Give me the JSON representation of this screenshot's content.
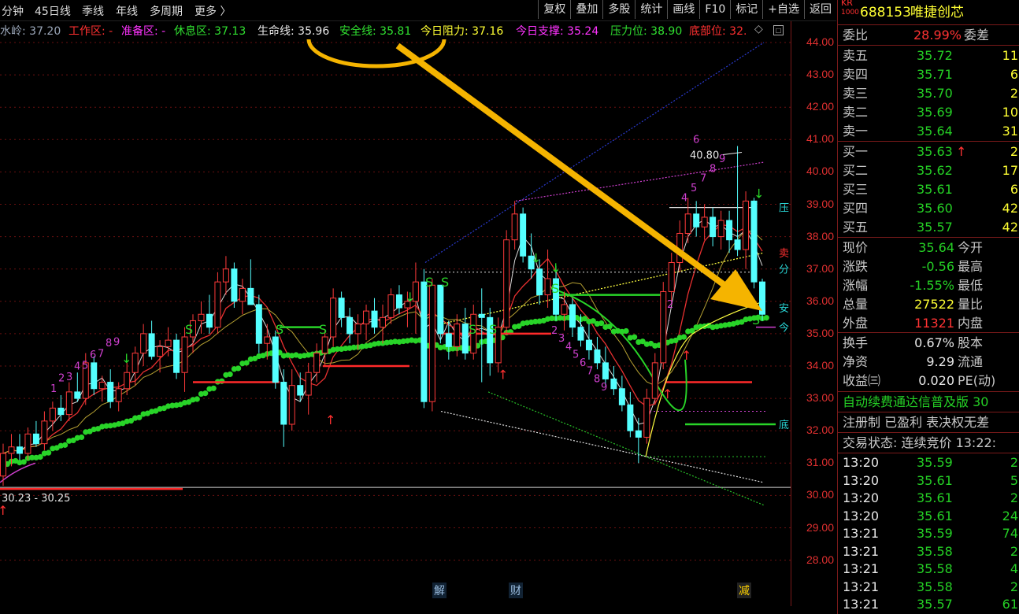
{
  "toolbar": {
    "tabs": [
      "分钟",
      "45日线",
      "季线",
      "年线",
      "多周期",
      "更多 〉"
    ],
    "buttons": [
      "复权",
      "叠加",
      "多股",
      "统计",
      "画线",
      "F10",
      "标记",
      "+自选",
      "返回"
    ]
  },
  "indicators": {
    "shuiling": "水岭: 37.20",
    "gongzuo": "工作区: -",
    "zhunbei": "准备区: -",
    "xiuxi": "休息区: 37.13",
    "shengming": "生命线: 35.96",
    "anquan": "安全线: 35.81",
    "zuli": "今日阻力: 37.16",
    "zhicheng": "今日支撑: 35.24",
    "yali": "压力位: 38.90",
    "dibu": "底部位: 32."
  },
  "price_axis": [
    "44.00",
    "43.00",
    "42.00",
    "41.00",
    "40.00",
    "39.00",
    "38.00",
    "37.00",
    "36.00",
    "35.00",
    "34.00",
    "33.00",
    "32.00",
    "31.00",
    "30.00",
    "29.00",
    "28.00"
  ],
  "chart_labels": {
    "high": "40.80",
    "low": "30.23 - 30.25",
    "event_jie": "解",
    "event_cai": "财",
    "event_jian": "减",
    "side_ya": "压",
    "side_fen": "分",
    "side_an": "安",
    "side_jin": "今",
    "side_di": "底",
    "side_mai": "卖"
  },
  "quote": {
    "badge_top": "KR",
    "badge_bottom": "1000",
    "code": "688153",
    "name": "唯捷创芯",
    "weibi_label": "委比",
    "weibi_value": "28.99%",
    "weicha_label": "委差",
    "asks": [
      {
        "label": "卖五",
        "price": "35.72",
        "vol": "11"
      },
      {
        "label": "卖四",
        "price": "35.71",
        "vol": "6"
      },
      {
        "label": "卖三",
        "price": "35.70",
        "vol": "2"
      },
      {
        "label": "卖二",
        "price": "35.69",
        "vol": "10"
      },
      {
        "label": "卖一",
        "price": "35.64",
        "vol": "31"
      }
    ],
    "bids": [
      {
        "label": "买一",
        "price": "35.63",
        "arrow": "↑",
        "vol": "2"
      },
      {
        "label": "买二",
        "price": "35.62",
        "arrow": "",
        "vol": "17"
      },
      {
        "label": "买三",
        "price": "35.61",
        "arrow": "",
        "vol": "6"
      },
      {
        "label": "买四",
        "price": "35.60",
        "arrow": "",
        "vol": "42"
      },
      {
        "label": "买五",
        "price": "35.57",
        "arrow": "",
        "vol": "42"
      }
    ],
    "stats": [
      {
        "label": "现价",
        "value": "35.64",
        "label2": "今开"
      },
      {
        "label": "涨跌",
        "value": "-0.56",
        "label2": "最高"
      },
      {
        "label": "涨幅",
        "value": "-1.55%",
        "label2": "最低"
      },
      {
        "label": "总量",
        "value": "27522",
        "label2": "量比"
      },
      {
        "label": "外盘",
        "value": "11321",
        "label2": "内盘"
      }
    ],
    "stats2": [
      {
        "label": "换手",
        "value": "0.67%",
        "label2": "股本"
      },
      {
        "label": "净资",
        "value": "9.29",
        "label2": "流通"
      },
      {
        "label": "收益㈢",
        "value": "0.020",
        "label2": "PE(动)"
      }
    ],
    "news": "自动续费通达信普及版 30",
    "status_line": "注册制 已盈利 表决权无差",
    "trade_state": "交易状态: 连续竞价 13:22:",
    "ticks": [
      {
        "time": "13:20",
        "price": "35.59",
        "vol": "2"
      },
      {
        "time": "13:20",
        "price": "35.61",
        "vol": "5"
      },
      {
        "time": "13:20",
        "price": "35.61",
        "vol": "2"
      },
      {
        "time": "13:20",
        "price": "35.61",
        "vol": "24"
      },
      {
        "time": "13:21",
        "price": "35.59",
        "vol": "74"
      },
      {
        "time": "13:21",
        "price": "35.58",
        "vol": "2"
      },
      {
        "time": "13:21",
        "price": "35.58",
        "vol": "4"
      },
      {
        "time": "13:21",
        "price": "35.58",
        "vol": "2"
      },
      {
        "time": "13:21",
        "price": "35.57",
        "vol": "61"
      }
    ]
  },
  "chart_data": {
    "type": "candlestick",
    "ylim": [
      27.3,
      44.4
    ],
    "candles": [
      [
        30.6,
        31.6,
        30.3,
        31.3
      ],
      [
        31.3,
        31.9,
        30.9,
        31.5
      ],
      [
        31.5,
        31.9,
        31.1,
        31.3
      ],
      [
        31.3,
        32.1,
        31.1,
        31.9
      ],
      [
        31.9,
        32.3,
        31.5,
        31.6
      ],
      [
        31.6,
        32.6,
        31.4,
        32.3
      ],
      [
        32.3,
        32.9,
        32.0,
        32.7
      ],
      [
        32.7,
        33.1,
        32.3,
        32.5
      ],
      [
        32.5,
        33.5,
        32.3,
        33.2
      ],
      [
        33.2,
        33.8,
        32.9,
        33.0
      ],
      [
        33.0,
        34.4,
        32.8,
        34.1
      ],
      [
        34.1,
        34.3,
        33.1,
        33.3
      ],
      [
        33.3,
        33.7,
        32.9,
        33.5
      ],
      [
        33.5,
        33.9,
        32.7,
        32.9
      ],
      [
        32.9,
        33.5,
        32.6,
        33.3
      ],
      [
        33.3,
        34.1,
        33.1,
        33.8
      ],
      [
        33.8,
        34.6,
        33.4,
        34.4
      ],
      [
        34.4,
        35.3,
        34.0,
        35.0
      ],
      [
        35.0,
        35.4,
        34.2,
        34.3
      ],
      [
        34.3,
        34.8,
        33.8,
        34.6
      ],
      [
        34.6,
        35.2,
        34.3,
        34.8
      ],
      [
        34.8,
        35.0,
        33.6,
        33.8
      ],
      [
        33.8,
        35.2,
        33.2,
        34.9
      ],
      [
        34.9,
        35.6,
        34.4,
        35.4
      ],
      [
        35.4,
        36.0,
        35.0,
        35.6
      ],
      [
        35.6,
        36.2,
        35.0,
        35.2
      ],
      [
        35.2,
        36.9,
        35.0,
        36.6
      ],
      [
        36.6,
        37.4,
        36.2,
        37.0
      ],
      [
        37.0,
        37.2,
        35.8,
        36.0
      ],
      [
        36.0,
        36.7,
        35.6,
        36.4
      ],
      [
        36.4,
        37.3,
        35.9,
        35.9
      ],
      [
        35.9,
        36.2,
        34.4,
        34.7
      ],
      [
        34.7,
        35.3,
        34.2,
        34.9
      ],
      [
        34.9,
        35.1,
        33.3,
        33.5
      ],
      [
        33.5,
        33.9,
        31.5,
        32.2
      ],
      [
        32.2,
        33.9,
        32.0,
        33.4
      ],
      [
        33.4,
        33.8,
        32.9,
        33.1
      ],
      [
        33.1,
        34.1,
        32.5,
        33.8
      ],
      [
        33.8,
        34.7,
        33.5,
        34.4
      ],
      [
        34.4,
        35.1,
        34.0,
        34.9
      ],
      [
        34.9,
        36.4,
        34.6,
        36.1
      ],
      [
        36.1,
        36.3,
        35.2,
        35.5
      ],
      [
        35.5,
        35.8,
        34.7,
        35.0
      ],
      [
        35.0,
        35.6,
        34.5,
        35.3
      ],
      [
        35.3,
        35.9,
        34.8,
        35.7
      ],
      [
        35.7,
        36.1,
        35.0,
        35.2
      ],
      [
        35.2,
        35.9,
        34.7,
        35.5
      ],
      [
        35.5,
        36.4,
        35.3,
        36.2
      ],
      [
        36.2,
        36.5,
        35.6,
        35.8
      ],
      [
        35.8,
        36.3,
        35.2,
        36.0
      ],
      [
        36.0,
        37.2,
        35.0,
        36.6
      ],
      [
        36.6,
        37.0,
        32.7,
        32.9
      ],
      [
        32.9,
        36.7,
        32.6,
        36.5
      ],
      [
        36.5,
        36.5,
        34.7,
        35.0
      ],
      [
        35.0,
        35.4,
        34.2,
        34.6
      ],
      [
        34.6,
        35.6,
        34.3,
        35.3
      ],
      [
        35.3,
        35.8,
        34.2,
        34.4
      ],
      [
        34.4,
        35.9,
        34.2,
        35.6
      ],
      [
        35.6,
        36.4,
        33.5,
        35.5
      ],
      [
        35.5,
        35.8,
        33.7,
        34.1
      ],
      [
        34.1,
        35.5,
        33.8,
        35.2
      ],
      [
        35.2,
        38.2,
        35.0,
        37.9
      ],
      [
        37.9,
        39.1,
        37.6,
        38.7
      ],
      [
        38.7,
        38.9,
        37.2,
        37.4
      ],
      [
        37.4,
        38.1,
        36.7,
        37.0
      ],
      [
        37.0,
        37.3,
        35.9,
        36.2
      ],
      [
        36.2,
        37.6,
        35.8,
        36.7
      ],
      [
        36.7,
        37.1,
        35.4,
        35.6
      ],
      [
        35.6,
        36.3,
        35.1,
        35.9
      ],
      [
        35.9,
        36.1,
        34.9,
        35.2
      ],
      [
        35.2,
        35.6,
        34.6,
        34.8
      ],
      [
        34.8,
        35.3,
        34.2,
        34.5
      ],
      [
        34.5,
        34.9,
        33.9,
        34.1
      ],
      [
        34.1,
        34.6,
        33.4,
        33.6
      ],
      [
        33.6,
        34.0,
        33.1,
        33.3
      ],
      [
        33.3,
        33.7,
        32.6,
        32.8
      ],
      [
        32.8,
        33.2,
        31.8,
        32.0
      ],
      [
        32.0,
        32.4,
        31.0,
        31.8
      ],
      [
        31.8,
        33.3,
        31.6,
        33.0
      ],
      [
        33.0,
        34.4,
        32.8,
        34.1
      ],
      [
        34.1,
        36.6,
        33.9,
        36.3
      ],
      [
        36.3,
        37.5,
        35.9,
        37.2
      ],
      [
        37.2,
        38.5,
        36.9,
        38.1
      ],
      [
        38.1,
        39.2,
        37.8,
        38.7
      ],
      [
        38.7,
        39.1,
        38.0,
        38.3
      ],
      [
        38.3,
        39.0,
        37.9,
        38.6
      ],
      [
        38.6,
        38.9,
        37.7,
        38.0
      ],
      [
        38.0,
        38.8,
        37.6,
        38.5
      ],
      [
        38.5,
        38.8,
        37.5,
        37.9
      ],
      [
        37.9,
        40.8,
        37.4,
        37.6
      ],
      [
        37.6,
        39.4,
        37.0,
        39.1
      ],
      [
        39.1,
        39.2,
        36.4,
        36.6
      ],
      [
        36.6,
        36.7,
        35.4,
        35.6
      ]
    ]
  }
}
